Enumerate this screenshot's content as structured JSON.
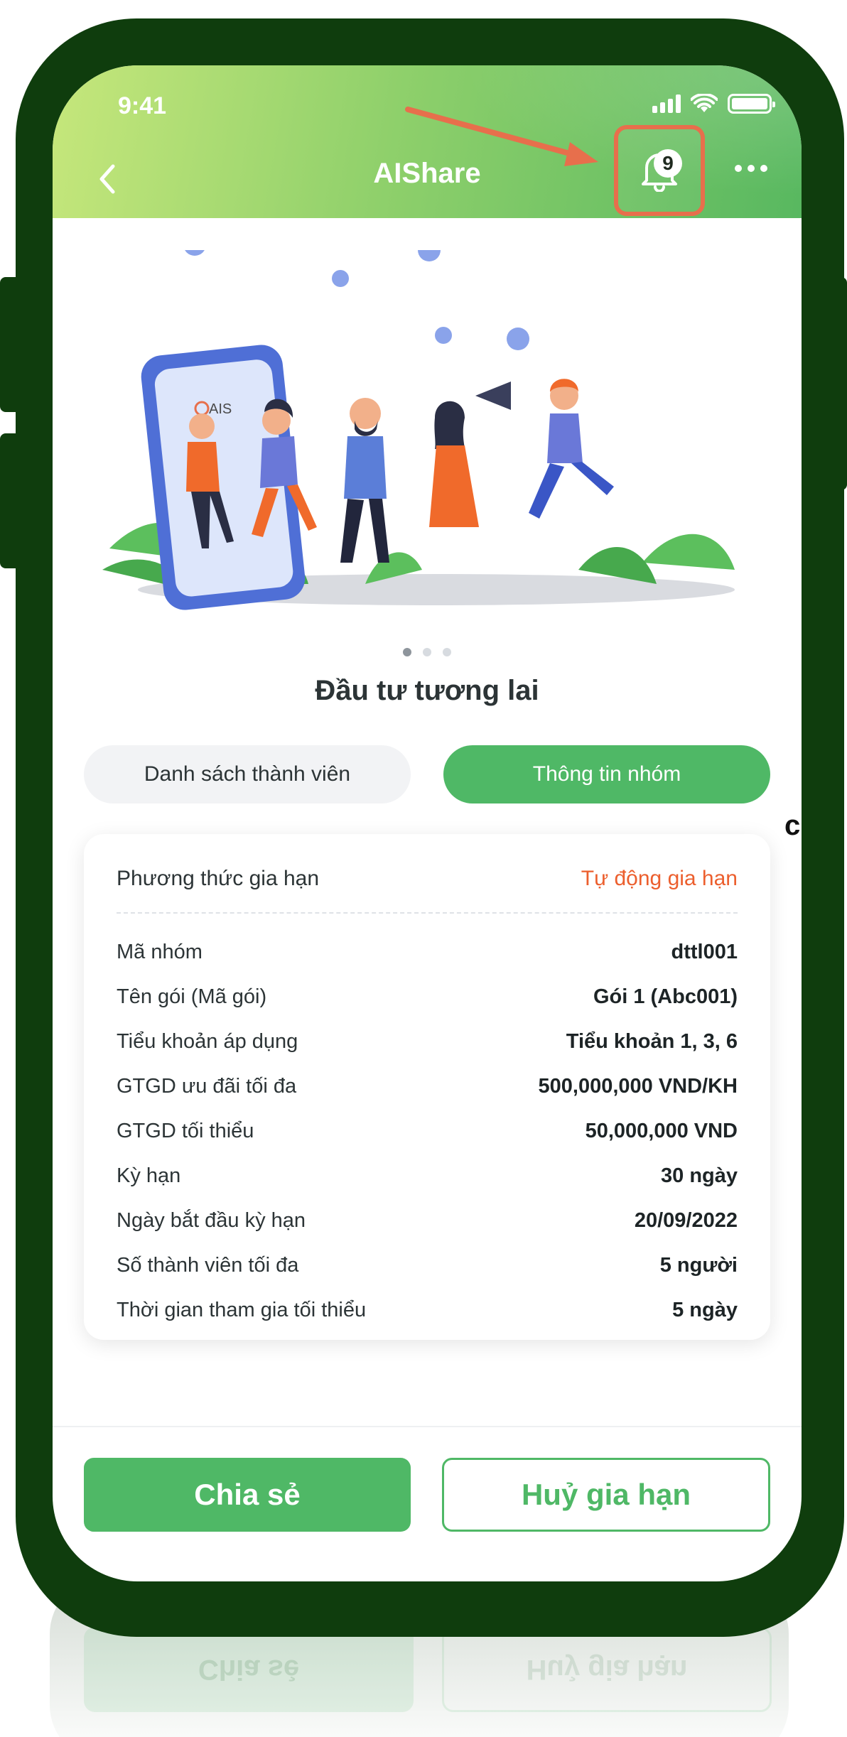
{
  "status_bar": {
    "time": "9:41"
  },
  "header": {
    "title": "AIShare",
    "notification_count": "9",
    "back_icon": "chevron-left-icon",
    "bell_icon": "bell-icon",
    "more_icon": "more-horizontal-icon"
  },
  "banner": {
    "brand": "AIS",
    "carousel_pages": 3,
    "active_page": 1
  },
  "group": {
    "name": "Đầu tư tương lai"
  },
  "tabs": [
    {
      "label": "Danh sách thành viên",
      "active": false
    },
    {
      "label": "Thông tin nhóm",
      "active": true
    }
  ],
  "info": {
    "renewal_method": {
      "label": "Phương thức gia hạn",
      "value": "Tự động gia hạn"
    },
    "rows": [
      {
        "label": "Mã nhóm",
        "value": "dttl001"
      },
      {
        "label": "Tên gói (Mã gói)",
        "value": "Gói 1 (Abc001)"
      },
      {
        "label": "Tiểu khoản áp dụng",
        "value": "Tiểu khoản 1, 3, 6"
      },
      {
        "label": "GTGD ưu đãi tối đa",
        "value": "500,000,000 VND/KH"
      },
      {
        "label": "GTGD tối thiểu",
        "value": "50,000,000 VND"
      },
      {
        "label": "Kỳ hạn",
        "value": "30 ngày"
      },
      {
        "label": "Ngày bắt đầu kỳ hạn",
        "value": "20/09/2022"
      },
      {
        "label": "Số thành viên tối đa",
        "value": "5 người"
      },
      {
        "label": "Thời gian tham gia tối thiểu",
        "value": "5 ngày"
      }
    ]
  },
  "actions": {
    "share_label": "Chia sẻ",
    "cancel_label": "Huỷ gia hạn"
  },
  "stray_char": "c",
  "colors": {
    "primary_green": "#4fb866",
    "frame": "#0f3d0d",
    "highlight": "#e76f4c",
    "renewal_value": "#ec5f2e"
  }
}
